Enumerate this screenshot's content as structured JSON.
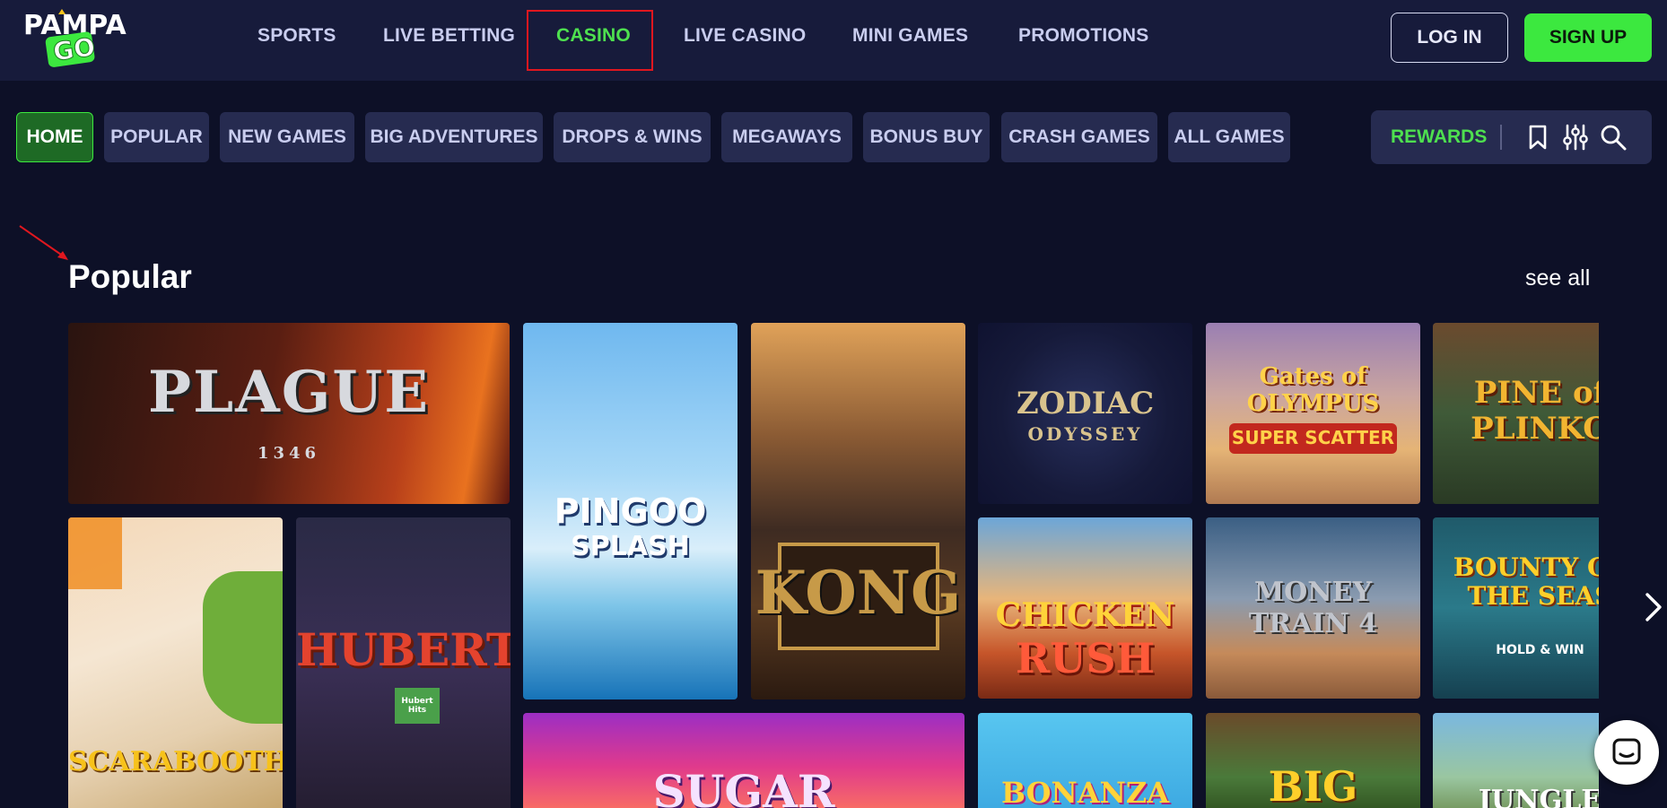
{
  "brand": {
    "line1": "PAMPA",
    "line2": "GO"
  },
  "nav": {
    "items": [
      "SPORTS",
      "LIVE BETTING",
      "CASINO",
      "LIVE CASINO",
      "MINI GAMES",
      "PROMOTIONS"
    ],
    "active": "CASINO",
    "login_label": "LOG IN",
    "signup_label": "SIGN UP"
  },
  "categories": [
    "HOME",
    "POPULAR",
    "NEW GAMES",
    "BIG ADVENTURES",
    "DROPS & WINS",
    "MEGAWAYS",
    "BONUS BUY",
    "CRASH GAMES",
    "ALL GAMES"
  ],
  "toolbar": {
    "rewards_label": "REWARDS",
    "icons": [
      "bookmark-icon",
      "filter-sliders-icon",
      "search-icon"
    ]
  },
  "section": {
    "title": "Popular",
    "see_all": "see all"
  },
  "games": [
    {
      "id": "plague",
      "title": "PLAGUE",
      "subtitle": "1346"
    },
    {
      "id": "pingoo",
      "title": "PINGOO",
      "subtitle": "SPLASH"
    },
    {
      "id": "kong",
      "title": "KONG"
    },
    {
      "id": "zodiac",
      "title": "ZODIAC",
      "subtitle": "ODYSSEY"
    },
    {
      "id": "olympus",
      "title": "Gates of OLYMPUS",
      "subtitle": "SUPER SCATTER"
    },
    {
      "id": "plinko",
      "title": "PINE of PLINKO"
    },
    {
      "id": "scarabooth",
      "title": "SCARABOOTH"
    },
    {
      "id": "hubert",
      "title": "HUBERT",
      "subtitle": "Hubert Hits"
    },
    {
      "id": "chicken",
      "title": "CHICKEN",
      "subtitle": "RUSH"
    },
    {
      "id": "moneytrain",
      "title": "MONEY TRAIN 4"
    },
    {
      "id": "bounty",
      "title": "BOUNTY OF THE SEAS",
      "subtitle": "HOLD & WIN"
    },
    {
      "id": "sugar",
      "title": "SUGAR"
    },
    {
      "id": "bonanza",
      "title": "BONANZA"
    },
    {
      "id": "big",
      "title": "BIG"
    },
    {
      "id": "jungle",
      "title": "JUNGLE"
    }
  ],
  "colors": {
    "bg": "#0d1027",
    "header": "#171b3b",
    "accent": "#3ce83f",
    "tab": "#262b50",
    "highlight_box": "#e0171f"
  }
}
